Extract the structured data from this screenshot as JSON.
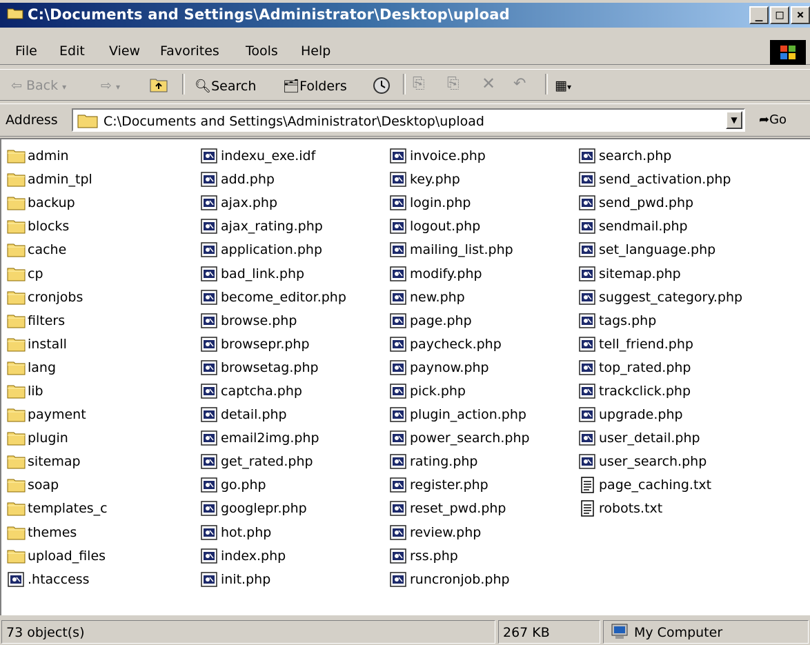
{
  "window": {
    "title": "C:\\Documents and Settings\\Administrator\\Desktop\\upload",
    "buttons": [
      "_",
      "□",
      "×"
    ]
  },
  "menu": [
    "File",
    "Edit",
    "View",
    "Favorites",
    "Tools",
    "Help"
  ],
  "toolbar": {
    "back": "Back",
    "search": "Search",
    "folders": "Folders"
  },
  "address": {
    "label": "Address",
    "value": "C:\\Documents and Settings\\Administrator\\Desktop\\upload",
    "go": "Go"
  },
  "columns": [
    [
      {
        "name": "admin",
        "type": "folder"
      },
      {
        "name": "admin_tpl",
        "type": "folder"
      },
      {
        "name": "backup",
        "type": "folder"
      },
      {
        "name": "blocks",
        "type": "folder"
      },
      {
        "name": "cache",
        "type": "folder"
      },
      {
        "name": "cp",
        "type": "folder"
      },
      {
        "name": "cronjobs",
        "type": "folder"
      },
      {
        "name": "filters",
        "type": "folder"
      },
      {
        "name": "install",
        "type": "folder"
      },
      {
        "name": "lang",
        "type": "folder"
      },
      {
        "name": "lib",
        "type": "folder"
      },
      {
        "name": "payment",
        "type": "folder"
      },
      {
        "name": "plugin",
        "type": "folder"
      },
      {
        "name": "sitemap",
        "type": "folder"
      },
      {
        "name": "soap",
        "type": "folder"
      },
      {
        "name": "templates_c",
        "type": "folder"
      },
      {
        "name": "themes",
        "type": "folder"
      },
      {
        "name": "upload_files",
        "type": "folder"
      },
      {
        "name": ".htaccess",
        "type": "php"
      }
    ],
    [
      {
        "name": "indexu_exe.idf",
        "type": "php"
      },
      {
        "name": "add.php",
        "type": "php"
      },
      {
        "name": "ajax.php",
        "type": "php"
      },
      {
        "name": "ajax_rating.php",
        "type": "php"
      },
      {
        "name": "application.php",
        "type": "php"
      },
      {
        "name": "bad_link.php",
        "type": "php"
      },
      {
        "name": "become_editor.php",
        "type": "php"
      },
      {
        "name": "browse.php",
        "type": "php"
      },
      {
        "name": "browsepr.php",
        "type": "php"
      },
      {
        "name": "browsetag.php",
        "type": "php"
      },
      {
        "name": "captcha.php",
        "type": "php"
      },
      {
        "name": "detail.php",
        "type": "php"
      },
      {
        "name": "email2img.php",
        "type": "php"
      },
      {
        "name": "get_rated.php",
        "type": "php"
      },
      {
        "name": "go.php",
        "type": "php"
      },
      {
        "name": "googlepr.php",
        "type": "php"
      },
      {
        "name": "hot.php",
        "type": "php"
      },
      {
        "name": "index.php",
        "type": "php"
      },
      {
        "name": "init.php",
        "type": "php"
      }
    ],
    [
      {
        "name": "invoice.php",
        "type": "php"
      },
      {
        "name": "key.php",
        "type": "php"
      },
      {
        "name": "login.php",
        "type": "php"
      },
      {
        "name": "logout.php",
        "type": "php"
      },
      {
        "name": "mailing_list.php",
        "type": "php"
      },
      {
        "name": "modify.php",
        "type": "php"
      },
      {
        "name": "new.php",
        "type": "php"
      },
      {
        "name": "page.php",
        "type": "php"
      },
      {
        "name": "paycheck.php",
        "type": "php"
      },
      {
        "name": "paynow.php",
        "type": "php"
      },
      {
        "name": "pick.php",
        "type": "php"
      },
      {
        "name": "plugin_action.php",
        "type": "php"
      },
      {
        "name": "power_search.php",
        "type": "php"
      },
      {
        "name": "rating.php",
        "type": "php"
      },
      {
        "name": "register.php",
        "type": "php"
      },
      {
        "name": "reset_pwd.php",
        "type": "php"
      },
      {
        "name": "review.php",
        "type": "php"
      },
      {
        "name": "rss.php",
        "type": "php"
      },
      {
        "name": "runcronjob.php",
        "type": "php"
      }
    ],
    [
      {
        "name": "search.php",
        "type": "php"
      },
      {
        "name": "send_activation.php",
        "type": "php"
      },
      {
        "name": "send_pwd.php",
        "type": "php"
      },
      {
        "name": "sendmail.php",
        "type": "php"
      },
      {
        "name": "set_language.php",
        "type": "php"
      },
      {
        "name": "sitemap.php",
        "type": "php"
      },
      {
        "name": "suggest_category.php",
        "type": "php"
      },
      {
        "name": "tags.php",
        "type": "php"
      },
      {
        "name": "tell_friend.php",
        "type": "php"
      },
      {
        "name": "top_rated.php",
        "type": "php"
      },
      {
        "name": "trackclick.php",
        "type": "php"
      },
      {
        "name": "upgrade.php",
        "type": "php"
      },
      {
        "name": "user_detail.php",
        "type": "php"
      },
      {
        "name": "user_search.php",
        "type": "php"
      },
      {
        "name": "page_caching.txt",
        "type": "txt"
      },
      {
        "name": "robots.txt",
        "type": "txt"
      }
    ]
  ],
  "status": {
    "objects": "73 object(s)",
    "size": "267 KB",
    "location": "My Computer"
  },
  "colors": {
    "title_gradient_start": "#0a246a",
    "title_gradient_end": "#a6caf0",
    "chrome": "#d4d0c8",
    "folder": "#f5d76e"
  }
}
